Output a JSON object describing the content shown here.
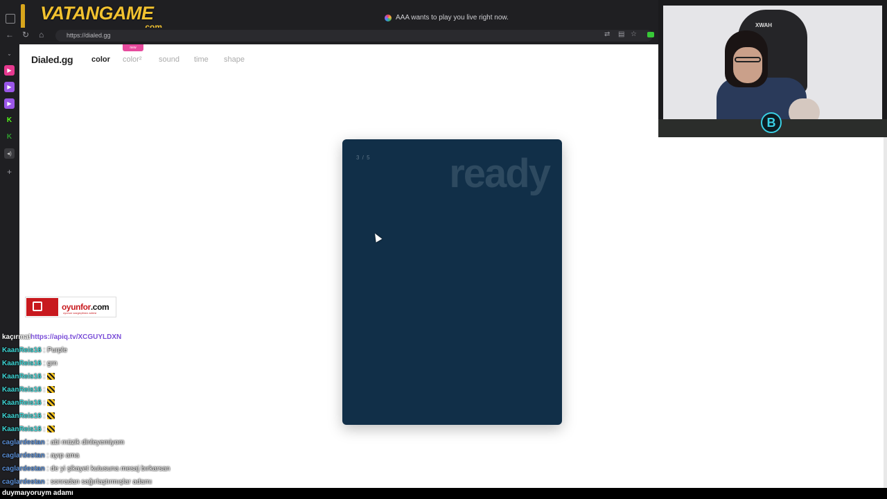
{
  "overlay": {
    "logo_text": "VATANGAME",
    "logo_suffix": ".com"
  },
  "browser": {
    "notification": "AAA wants to play you live right now.",
    "url": "https://dialed.gg"
  },
  "site": {
    "brand": "Dialed.gg",
    "nav": [
      "color",
      "color²",
      "sound",
      "time",
      "shape"
    ],
    "new_badge": "new"
  },
  "card": {
    "counter": "3 / 5",
    "status": "ready",
    "color": "#112f48"
  },
  "webcam": {
    "chair_text": "XWAH",
    "badge": "B"
  },
  "sponsor": {
    "name_part1": "oyunfor",
    "name_part2": ".com",
    "tagline": "oyunun vazgeçilmez adresi"
  },
  "chat": [
    {
      "user": "kaçırma!",
      "message": "https://apiq.tv/XCGUYLDXN",
      "user_color": "#ffffff",
      "is_link": true
    },
    {
      "user": "KaanReis16",
      "message": " : Purple",
      "user_color": "#3fd8d8"
    },
    {
      "user": "KaanReis16",
      "message": " : grn",
      "user_color": "#3fd8d8"
    },
    {
      "user": "KaanReis16",
      "message": " : ",
      "user_color": "#3fd8d8",
      "emote": true
    },
    {
      "user": "KaanReis16",
      "message": " : ",
      "user_color": "#3fd8d8",
      "emote": true
    },
    {
      "user": "KaanReis16",
      "message": " : ",
      "user_color": "#3fd8d8",
      "emote": true
    },
    {
      "user": "KaanReis16",
      "message": " : ",
      "user_color": "#3fd8d8",
      "emote": true
    },
    {
      "user": "KaanReis16",
      "message": " : ",
      "user_color": "#3fd8d8",
      "emote": true
    },
    {
      "user": "caglardestan",
      "message": " : abi müzik dinleyemiyom",
      "user_color": "#5b8fd6"
    },
    {
      "user": "caglardestan",
      "message": " : ayıp ama",
      "user_color": "#5b8fd6"
    },
    {
      "user": "caglardestan",
      "message": " : de yi şikayet kutusuna mesaj bırkarsan",
      "user_color": "#5b8fd6"
    },
    {
      "user": "caglardestan",
      "message": " : sonradan sağırlaştırmışlar adamı",
      "user_color": "#5b8fd6"
    }
  ],
  "bottom_line": "duymaıyoruym adamı"
}
